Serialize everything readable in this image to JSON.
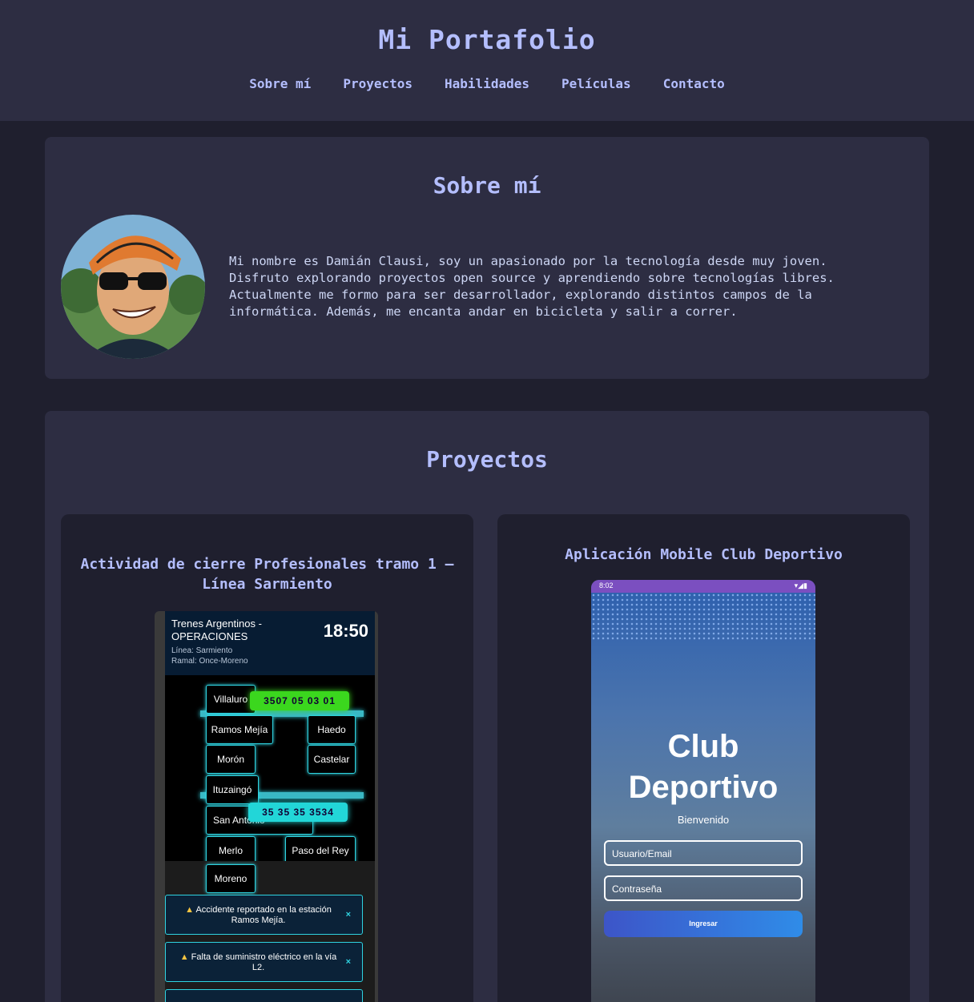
{
  "header": {
    "title": "Mi Portafolio",
    "nav": [
      "Sobre mí",
      "Proyectos",
      "Habilidades",
      "Películas",
      "Contacto"
    ]
  },
  "about": {
    "title": "Sobre mí",
    "text": "Mi nombre es Damián Clausi, soy un apasionado por la tecnología desde muy joven. Disfruto explorando proyectos open source y aprendiendo sobre tecnologías libres. Actualmente me formo para ser desarrollador, explorando distintos campos de la informática. Además, me encanta andar en bicicleta y salir a correr."
  },
  "projects": {
    "title": "Proyectos",
    "cards": [
      {
        "title": "Actividad de cierre Profesionales tramo 1 – Línea Sarmiento",
        "screen": {
          "org_line1": "Trenes Argentinos -",
          "org_line2": "OPERACIONES",
          "clock": "18:50",
          "line": "Línea: Sarmiento",
          "branch": "Ramal: Once-Moreno",
          "stations": [
            "Villaluro",
            "Ramos Mejía",
            "Haedo",
            "Morón",
            "Castelar",
            "Ituzaingó",
            "San Antonio",
            "Merlo",
            "Paso del Rey",
            "Moreno"
          ],
          "trains": [
            "3507 05 03 01",
            "35 35 35 3534"
          ],
          "alerts": [
            "Accidente reportado en la estación Ramos Mejía.",
            "Falta de suministro eléctrico en la vía L2."
          ]
        }
      },
      {
        "title": "Aplicación Mobile Club Deportivo",
        "screen": {
          "time": "8:02",
          "app_title": "Club Deportivo",
          "welcome": "Bienvenido",
          "user_placeholder": "Usuario/Email",
          "pass_placeholder": "Contraseña",
          "login_button": "Ingresar"
        }
      }
    ]
  }
}
